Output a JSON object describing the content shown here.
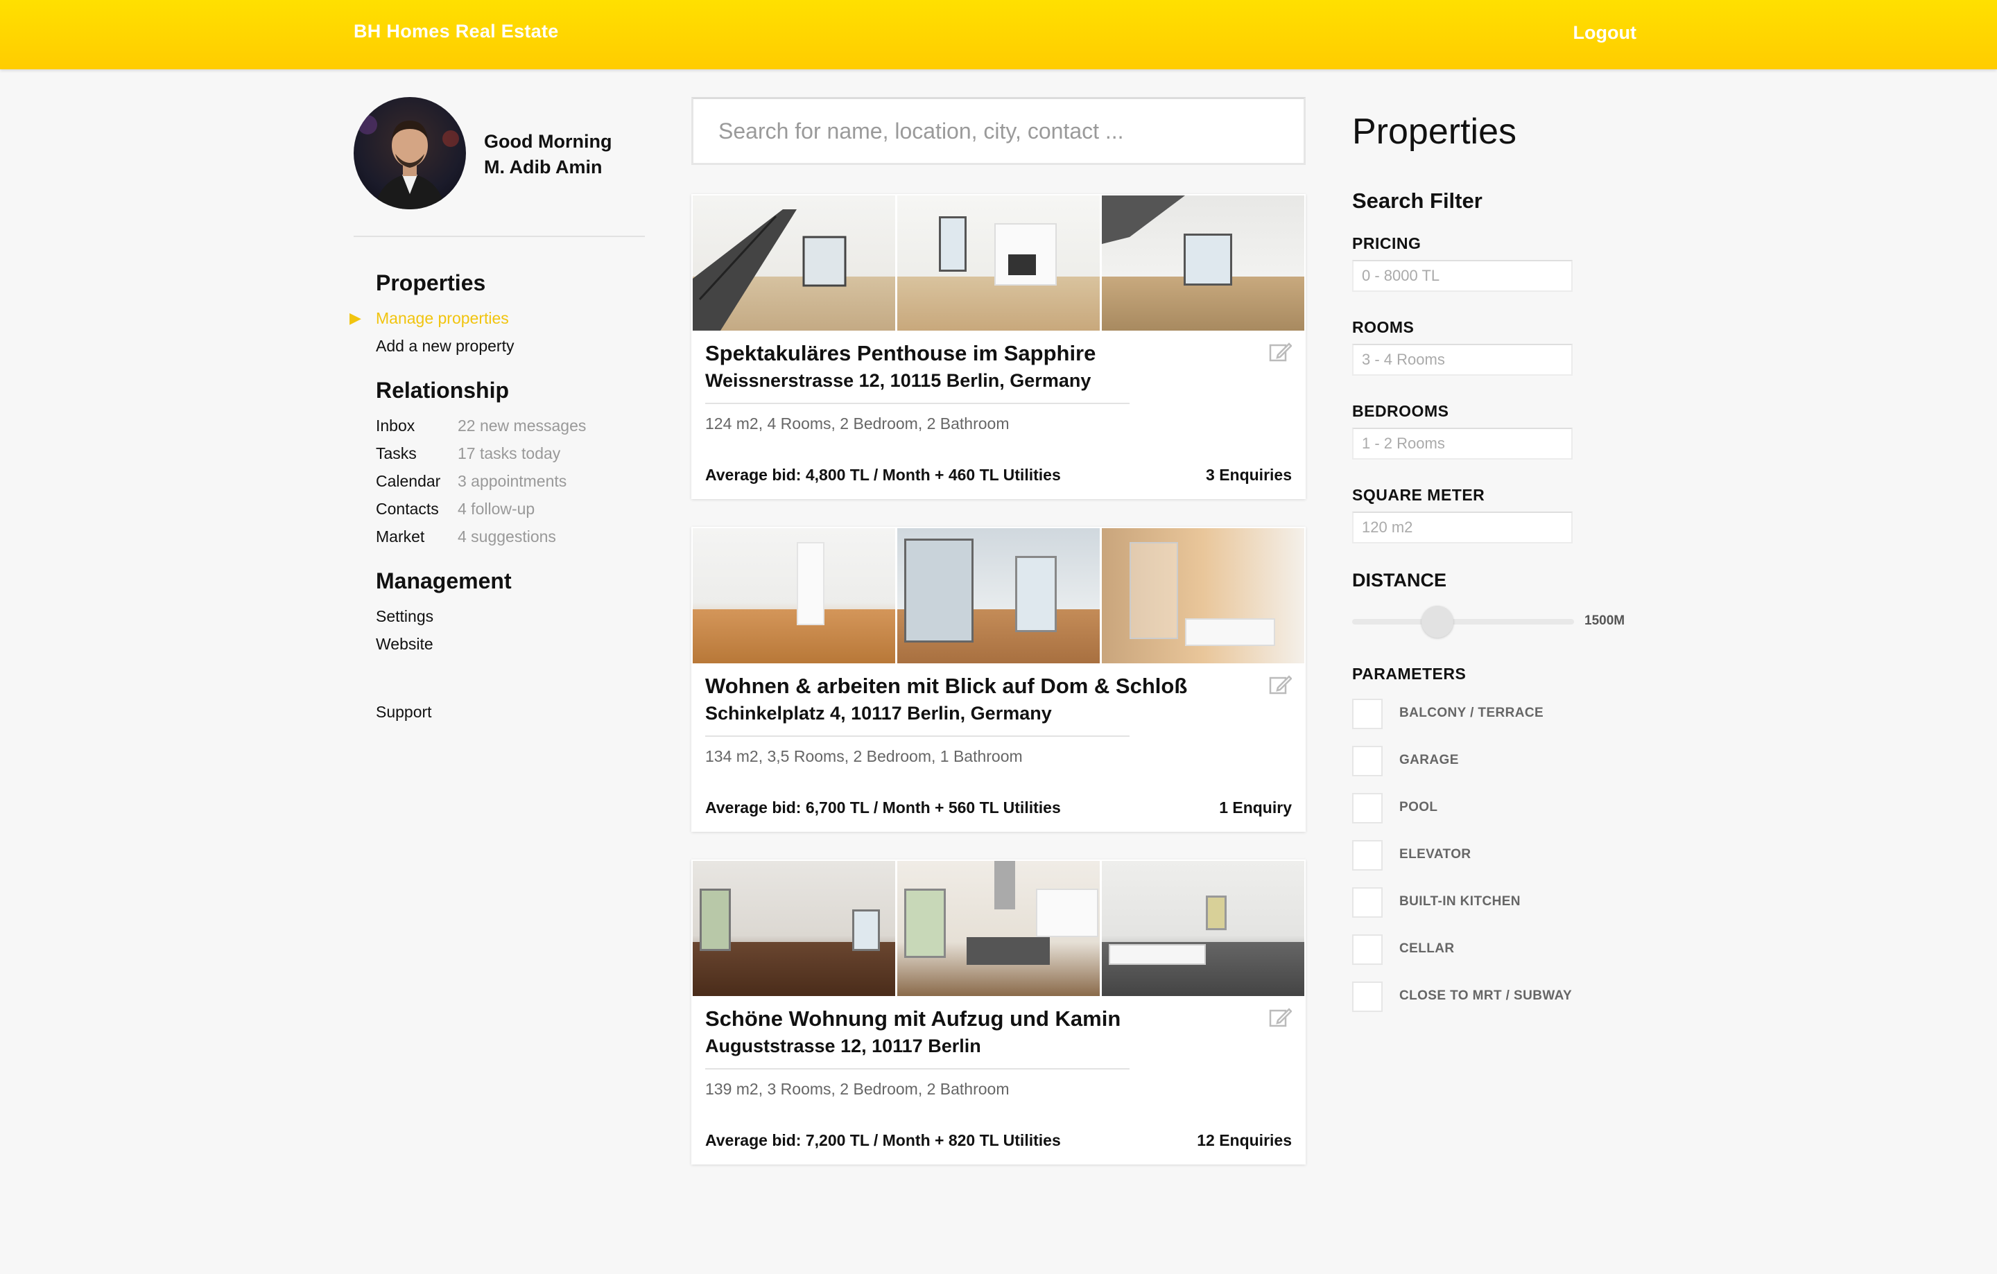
{
  "header": {
    "brand": "BH Homes Real Estate",
    "logout": "Logout"
  },
  "user": {
    "greeting": "Good Morning",
    "name": "M. Adib Amin"
  },
  "nav": {
    "properties": {
      "title": "Properties",
      "items": [
        {
          "label": "Manage properties",
          "active": true
        },
        {
          "label": "Add a new property"
        }
      ]
    },
    "relationship": {
      "title": "Relationship",
      "items": [
        {
          "label": "Inbox",
          "sub": "22 new messages"
        },
        {
          "label": "Tasks",
          "sub": "17 tasks today"
        },
        {
          "label": "Calendar",
          "sub": "3 appointments"
        },
        {
          "label": "Contacts",
          "sub": "4 follow-up"
        },
        {
          "label": "Market",
          "sub": "4 suggestions"
        }
      ]
    },
    "management": {
      "title": "Management",
      "items": [
        {
          "label": "Settings"
        },
        {
          "label": "Website"
        }
      ]
    },
    "support": "Support"
  },
  "search": {
    "placeholder": "Search for name, location, city, contact ..."
  },
  "listings": [
    {
      "title": "Spektakuläres Penthouse im Sapphire",
      "address": "Weissnerstrasse 12, 10115 Berlin, Germany",
      "specs": "124 m2, 4 Rooms, 2 Bedroom, 2 Bathroom",
      "bid": "Average bid: 4,800 TL / Month + 460 TL Utilities",
      "enquiries": "3 Enquiries"
    },
    {
      "title": "Wohnen & arbeiten mit Blick auf Dom & Schloß",
      "address": "Schinkelplatz 4, 10117 Berlin, Germany",
      "specs": "134 m2, 3,5 Rooms, 2 Bedroom, 1 Bathroom",
      "bid": "Average bid: 6,700 TL / Month + 560 TL Utilities",
      "enquiries": "1 Enquiry"
    },
    {
      "title": "Schöne Wohnung mit Aufzug und Kamin",
      "address": "Auguststrasse 12, 10117 Berlin",
      "specs": "139 m2, 3 Rooms, 2 Bedroom, 2 Bathroom",
      "bid": "Average bid: 7,200 TL / Month + 820 TL Utilities",
      "enquiries": "12 Enquiries"
    }
  ],
  "filter": {
    "title": "Properties",
    "subtitle": "Search Filter",
    "pricing": {
      "label": "PRICING",
      "placeholder": "0 - 8000 TL"
    },
    "rooms": {
      "label": "ROOMS",
      "placeholder": "3 - 4 Rooms"
    },
    "bedrooms": {
      "label": "BEDROOMS",
      "placeholder": "1 - 2 Rooms"
    },
    "sqm": {
      "label": "SQUARE METER",
      "placeholder": "120 m2"
    },
    "distance": {
      "label": "DISTANCE",
      "value": "1500M",
      "level": 0.22
    },
    "parameters": {
      "label": "PARAMETERS",
      "items": [
        "BALCONY / TERRACE",
        "GARAGE",
        "POOL",
        "ELEVATOR",
        "BUILT-IN KITCHEN",
        "CELLAR",
        "CLOSE TO MRT / SUBWAY"
      ]
    }
  },
  "colors": {
    "accent": "#f1c40f",
    "header_top": "#ffe000",
    "header_bottom": "#ffcc00"
  }
}
